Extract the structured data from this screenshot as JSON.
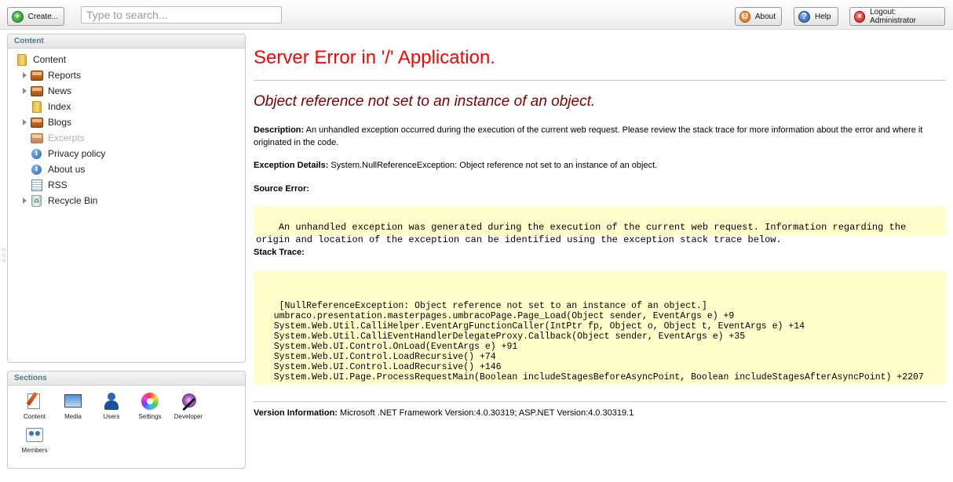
{
  "toolbar": {
    "create_label": "Create...",
    "search_placeholder": "Type to search...",
    "about_label": "About",
    "help_label": "Help",
    "logout_label": "Logout: Administrator"
  },
  "content_panel": {
    "title": "Content",
    "tree": [
      {
        "label": "Content"
      },
      {
        "label": "Reports"
      },
      {
        "label": "News"
      },
      {
        "label": "Index"
      },
      {
        "label": "Blogs"
      },
      {
        "label": "Excerpts"
      },
      {
        "label": "Privacy policy"
      },
      {
        "label": "About us"
      },
      {
        "label": "RSS"
      },
      {
        "label": "Recycle Bin"
      }
    ]
  },
  "sections_panel": {
    "title": "Sections",
    "items": [
      {
        "label": "Content"
      },
      {
        "label": "Media"
      },
      {
        "label": "Users"
      },
      {
        "label": "Settings"
      },
      {
        "label": "Developer"
      },
      {
        "label": "Members"
      }
    ]
  },
  "error": {
    "title": "Server Error in '/' Application.",
    "subtitle": "Object reference not set to an instance of an object.",
    "description_label": "Description:",
    "description_text": "An unhandled exception occurred during the execution of the current web request. Please review the stack trace for more information about the error and where it originated in the code.",
    "exception_label": "Exception Details:",
    "exception_text": "System.NullReferenceException: Object reference not set to an instance of an object.",
    "source_error_label": "Source Error:",
    "source_error_text": "An unhandled exception was generated during the execution of the current web request. Information regarding the\norigin and location of the exception can be identified using the exception stack trace below.",
    "stack_trace_label": "Stack Trace:",
    "stack_trace_text": "[NullReferenceException: Object reference not set to an instance of an object.]\n   umbraco.presentation.masterpages.umbracoPage.Page_Load(Object sender, EventArgs e) +9\n   System.Web.Util.CalliHelper.EventArgFunctionCaller(IntPtr fp, Object o, Object t, EventArgs e) +14\n   System.Web.Util.CalliEventHandlerDelegateProxy.Callback(Object sender, EventArgs e) +35\n   System.Web.UI.Control.OnLoad(EventArgs e) +91\n   System.Web.UI.Control.LoadRecursive() +74\n   System.Web.UI.Control.LoadRecursive() +146\n   System.Web.UI.Page.ProcessRequestMain(Boolean includeStagesBeforeAsyncPoint, Boolean includeStagesAfterAsyncPoint) +2207",
    "version_label": "Version Information:",
    "version_text": "Microsoft .NET Framework Version:4.0.30319; ASP.NET Version:4.0.30319.1"
  }
}
